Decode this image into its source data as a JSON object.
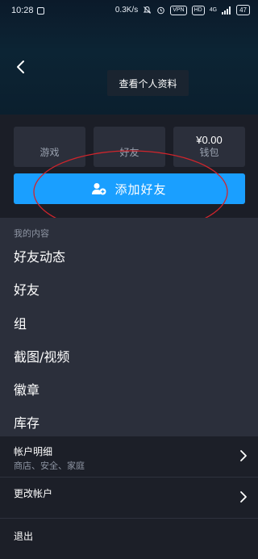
{
  "status": {
    "time": "10:28",
    "speed": "0.3K/s",
    "vpn": "VPN",
    "hd": "HD",
    "network": "4G",
    "battery": "47"
  },
  "header": {
    "view_profile_label": "查看个人资料"
  },
  "stats": [
    {
      "label": "游戏",
      "value": ""
    },
    {
      "label": "好友",
      "value": ""
    },
    {
      "label": "钱包",
      "value": "¥0.00"
    }
  ],
  "add_friend": {
    "label": "添加好友"
  },
  "menu": {
    "section_title": "我的内容",
    "items": [
      "好友动态",
      "好友",
      "组",
      "截图/视频",
      "徽章",
      "库存"
    ]
  },
  "account": {
    "details_title": "帐户明细",
    "details_sub": "商店、安全、家庭",
    "change_label": "更改帐户",
    "logout_label": "退出"
  },
  "colors": {
    "accent": "#1a9fff",
    "annotation": "#d0252c"
  }
}
